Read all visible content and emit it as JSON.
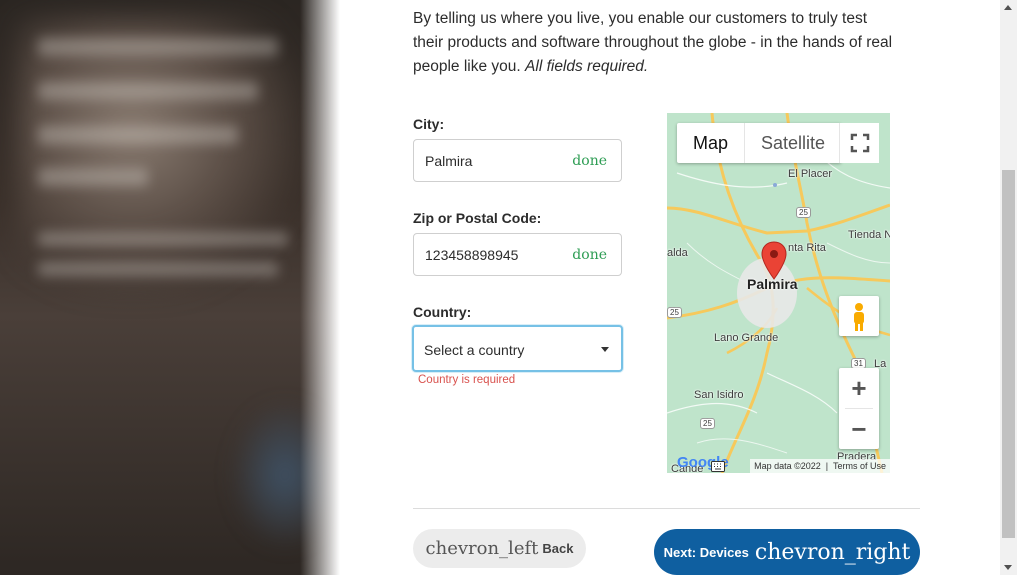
{
  "intro": {
    "text": "By telling us where you live, you enable our customers to truly test their products and software throughout the globe - in the hands of real people like you.",
    "required_note": "All fields required."
  },
  "form": {
    "city": {
      "label": "City:",
      "value": "Palmira",
      "status": "done"
    },
    "zip": {
      "label": "Zip or Postal Code:",
      "value": "123458898945",
      "status": "done"
    },
    "country": {
      "label": "Country:",
      "selected": "Select a country",
      "error": "Country is required"
    }
  },
  "map": {
    "type_controls": {
      "map": "Map",
      "satellite": "Satellite"
    },
    "places": {
      "el_placer": "El Placer",
      "tienda": "Tienda N",
      "santa_rita": "nta Rita",
      "alda": "alda",
      "palmira": "Palmira",
      "lano_grande": "Lano Grande",
      "san_isidro": "San Isidro",
      "pradera": "Pradera",
      "la": "La",
      "cande": "Cande"
    },
    "route_shields": {
      "r25a": "25",
      "r25b": "25",
      "r25c": "25",
      "r31": "31"
    },
    "zoom": {
      "in": "+",
      "out": "−"
    },
    "logo": "Google",
    "attribution": {
      "data": "Map data ©2022",
      "terms": "Terms of Use"
    }
  },
  "nav": {
    "back": {
      "icon": "chevron_left",
      "label": "Back"
    },
    "next": {
      "label": "Next: Devices",
      "icon": "chevron_right"
    }
  },
  "colors": {
    "primary": "#0f5fa0",
    "done": "#2e9d54",
    "error": "#d9534f",
    "focus": "#76c1e6"
  }
}
